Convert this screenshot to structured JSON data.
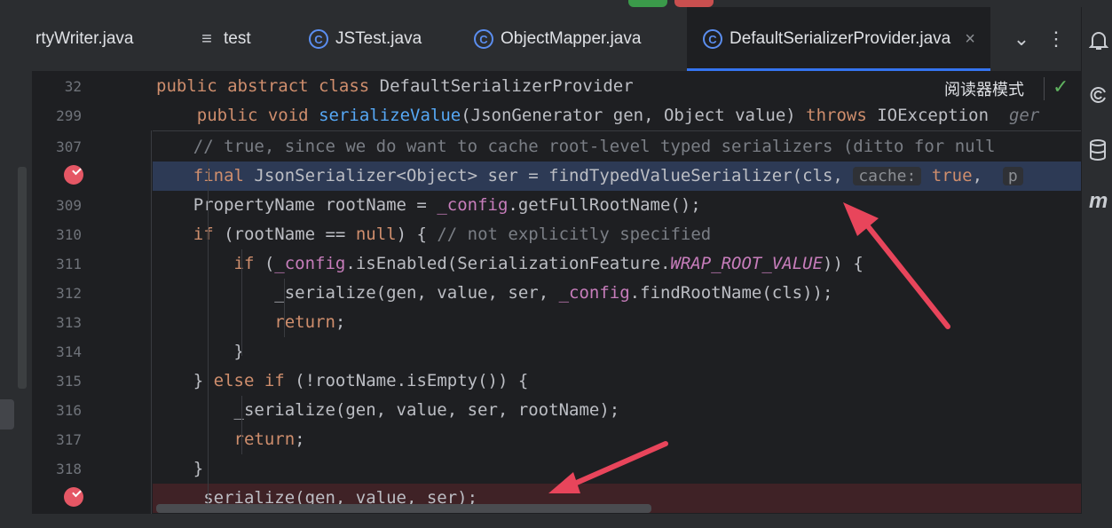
{
  "tabs": [
    {
      "label": "rtyWriter.java",
      "icon": "none",
      "active": false
    },
    {
      "label": "test",
      "icon": "list-icon",
      "active": false
    },
    {
      "label": "JSTest.java",
      "icon": "class-icon",
      "active": false
    },
    {
      "label": "ObjectMapper.java",
      "icon": "class-icon",
      "active": false
    },
    {
      "label": "DefaultSerializerProvider.java",
      "icon": "class-icon",
      "active": true
    }
  ],
  "tab_close": "×",
  "tab_tools": {
    "dropdown": "⌄",
    "more": "⋮"
  },
  "reader_mode": {
    "label": "阅读器模式",
    "check": "✓"
  },
  "lines": [
    {
      "no": "32"
    },
    {
      "no": "299"
    },
    {
      "no": "307"
    },
    {
      "no": ""
    },
    {
      "no": "309"
    },
    {
      "no": "310"
    },
    {
      "no": "311"
    },
    {
      "no": "312"
    },
    {
      "no": "313"
    },
    {
      "no": "314"
    },
    {
      "no": "315"
    },
    {
      "no": "316"
    },
    {
      "no": "317"
    },
    {
      "no": "318"
    },
    {
      "no": ""
    }
  ],
  "code": {
    "l32": {
      "kw": "public abstract class",
      "rest": " DefaultSerializerProvider"
    },
    "l299": {
      "kw1": "public void",
      "fn": "serializeValue",
      "rest": "(JsonGenerator gen, Object value) ",
      "kw2": "throws",
      "rest2": " IOException  ",
      "hint": "ger"
    },
    "l307": {
      "comment": "// true, since we do want to cache root-level typed serializers (ditto for null"
    },
    "l308": {
      "kw": "final",
      "rest": " JsonSerializer<Object> ser = findTypedValueSerializer(cls, ",
      "hint": "cache:",
      "kw2": "true",
      "rest2": ",  ",
      "hint2": "p"
    },
    "l309": {
      "a": "PropertyName rootName = ",
      "fld": "_config",
      "b": ".getFullRootName();"
    },
    "l310": {
      "kw": "if",
      "a": " (rootName == ",
      "kw2": "null",
      "b": ") { ",
      "comment": "// not explicitly specified"
    },
    "l311": {
      "kw": "if",
      "a": " (",
      "fld": "_config",
      "b": ".isEnabled(SerializationFeature.",
      "ital": "WRAP_ROOT_VALUE",
      "c": ")) {"
    },
    "l312": {
      "a": "_serialize(gen, value, ser, ",
      "fld": "_config",
      "b": ".findRootName(cls));"
    },
    "l313": {
      "kw": "return",
      "a": ";"
    },
    "l314": {
      "a": "}"
    },
    "l315": {
      "a": "} ",
      "kw": "else if",
      "b": " (!rootName.isEmpty()) {"
    },
    "l316": {
      "a": "_serialize(gen, value, ser, rootName);"
    },
    "l317": {
      "kw": "return",
      "a": ";"
    },
    "l318": {
      "a": "}"
    },
    "l319": {
      "a": "_serialize(gen, value, ser);"
    }
  },
  "right_tools": [
    "bell-icon",
    "swirl-icon",
    "database-icon",
    "m-icon"
  ],
  "colors": {
    "accent": "#3574f0",
    "breakpoint": "#e55765",
    "arrow": "#e8455b"
  }
}
